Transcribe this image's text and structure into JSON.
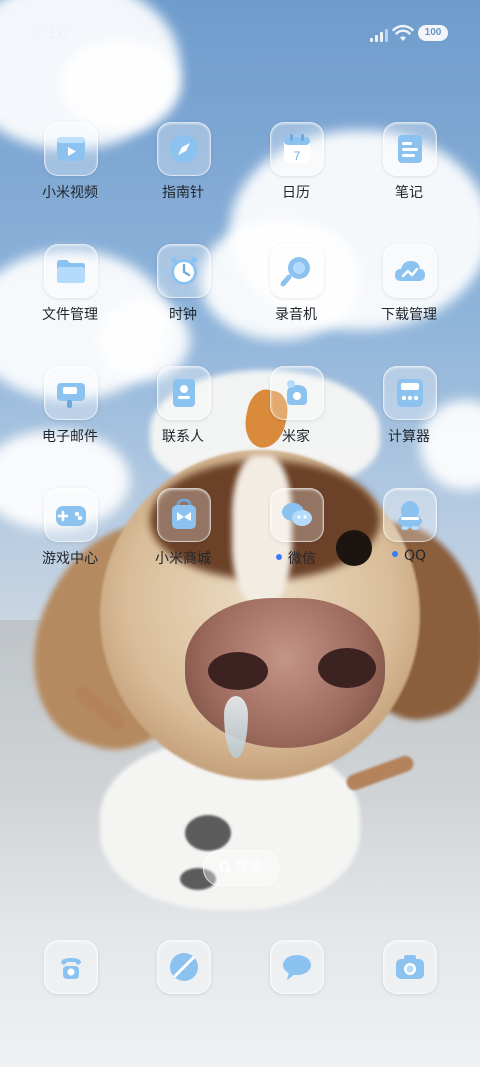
{
  "status_bar": {
    "time": "8:16",
    "battery": "100"
  },
  "apps": [
    {
      "label": "小米视频",
      "icon": "video-icon",
      "dot": false
    },
    {
      "label": "指南针",
      "icon": "compass-icon",
      "dot": false
    },
    {
      "label": "日历",
      "icon": "calendar-icon",
      "date": "7",
      "dot": false
    },
    {
      "label": "笔记",
      "icon": "notes-icon",
      "dot": false
    },
    {
      "label": "文件管理",
      "icon": "folder-icon",
      "dot": false
    },
    {
      "label": "时钟",
      "icon": "clock-icon",
      "dot": false
    },
    {
      "label": "录音机",
      "icon": "recorder-icon",
      "dot": false
    },
    {
      "label": "下载管理",
      "icon": "download-cloud-icon",
      "dot": false
    },
    {
      "label": "电子邮件",
      "icon": "mail-icon",
      "dot": false
    },
    {
      "label": "联系人",
      "icon": "contacts-icon",
      "dot": false
    },
    {
      "label": "米家",
      "icon": "mijia-icon",
      "dot": false
    },
    {
      "label": "计算器",
      "icon": "calculator-icon",
      "dot": false
    },
    {
      "label": "游戏中心",
      "icon": "gamepad-icon",
      "dot": false
    },
    {
      "label": "小米商城",
      "icon": "shop-bag-icon",
      "dot": false
    },
    {
      "label": "微信",
      "icon": "wechat-icon",
      "dot": true
    },
    {
      "label": "QQ",
      "icon": "qq-icon",
      "dot": true
    }
  ],
  "search": {
    "label": "搜索",
    "icon": "search-icon"
  },
  "dock": [
    {
      "icon": "phone-icon"
    },
    {
      "icon": "browser-icon"
    },
    {
      "icon": "messages-icon"
    },
    {
      "icon": "camera-icon"
    }
  ],
  "colors": {
    "icon_accent": "#8cc2f0",
    "notification_dot": "#3b7cff",
    "label_text": "#22272d"
  }
}
